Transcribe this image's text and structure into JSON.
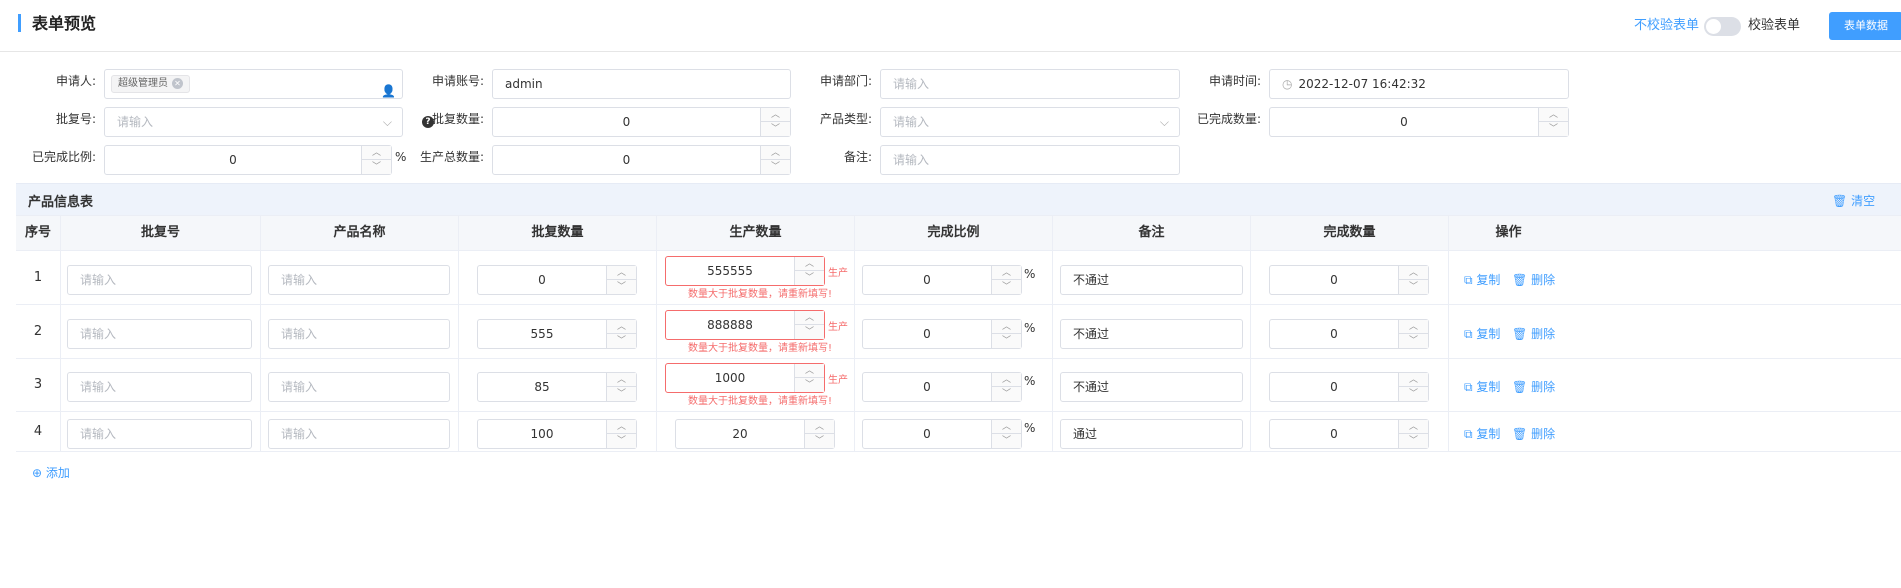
{
  "header": {
    "title": "表单预览",
    "toggle_left_label": "不校验表单",
    "toggle_right_label": "校验表单",
    "primary_button": "表单数据"
  },
  "form": {
    "applicant": {
      "label": "申请人:",
      "tag": "超级管理员"
    },
    "account": {
      "label": "申请账号:",
      "value": "admin"
    },
    "department": {
      "label": "申请部门:",
      "placeholder": "请输入"
    },
    "apply_time": {
      "label": "申请时间:",
      "value": "2022-12-07 16:42:32"
    },
    "batch_no": {
      "label": "批复号:",
      "placeholder": "请输入"
    },
    "approved_qty": {
      "label": "批复数量:",
      "value": "0"
    },
    "product_type": {
      "label": "产品类型:",
      "placeholder": "请输入"
    },
    "completed_qty": {
      "label": "已完成数量:",
      "value": "0"
    },
    "completed_ratio": {
      "label": "已完成比例:",
      "value": "0",
      "unit": "%"
    },
    "production_total": {
      "label": "生产总数量:",
      "value": "0"
    },
    "remark": {
      "label": "备注:",
      "placeholder": "请输入"
    }
  },
  "table": {
    "title": "产品信息表",
    "clear_label": "清空",
    "headers": [
      "序号",
      "批复号",
      "产品名称",
      "批复数量",
      "生产数量",
      "完成比例",
      "备注",
      "完成数量",
      "操作"
    ],
    "placeholder": "请输入",
    "unit": "%",
    "copy_label": "复制",
    "delete_label": "删除",
    "side_note": "生产",
    "rows": [
      {
        "index": "1",
        "approved": "0",
        "production": "555555",
        "ratio": "0",
        "remark": "不通过",
        "completed": "0",
        "error": "数量大于批复数量，请重新填写!"
      },
      {
        "index": "2",
        "approved": "555",
        "production": "888888",
        "ratio": "0",
        "remark": "不通过",
        "completed": "0",
        "error": "数量大于批复数量，请重新填写!"
      },
      {
        "index": "3",
        "approved": "85",
        "production": "1000",
        "ratio": "0",
        "remark": "不通过",
        "completed": "0",
        "error": "数量大于批复数量，请重新填写!"
      },
      {
        "index": "4",
        "approved": "100",
        "production": "20",
        "ratio": "0",
        "remark": "通过",
        "completed": "0"
      }
    ],
    "add_label": "添加"
  },
  "colors": {
    "accent": "#409eff",
    "error": "#f56c6c"
  }
}
